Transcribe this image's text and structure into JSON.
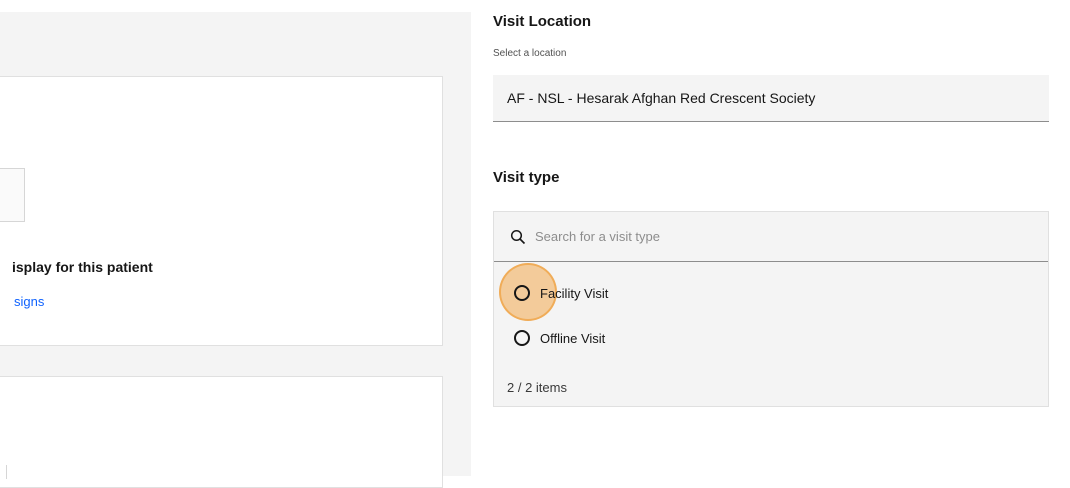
{
  "left_panel": {
    "empty_state_title": "isplay for this patient",
    "empty_state_link": "signs"
  },
  "visit_location": {
    "title": "Visit Location",
    "helper": "Select a location",
    "selected": "AF - NSL - Hesarak Afghan Red Crescent Society"
  },
  "visit_type": {
    "title": "Visit type",
    "search_placeholder": "Search for a visit type",
    "options": [
      {
        "label": "Facility Visit",
        "selected": false
      },
      {
        "label": "Offline Visit",
        "selected": false
      }
    ],
    "count": "2 / 2 items"
  },
  "icons": {
    "search": "search-icon",
    "radio": "radio-icon"
  },
  "colors": {
    "link": "#0f62fe",
    "field_bg": "#f4f4f4",
    "highlight": "#f2aa50"
  }
}
